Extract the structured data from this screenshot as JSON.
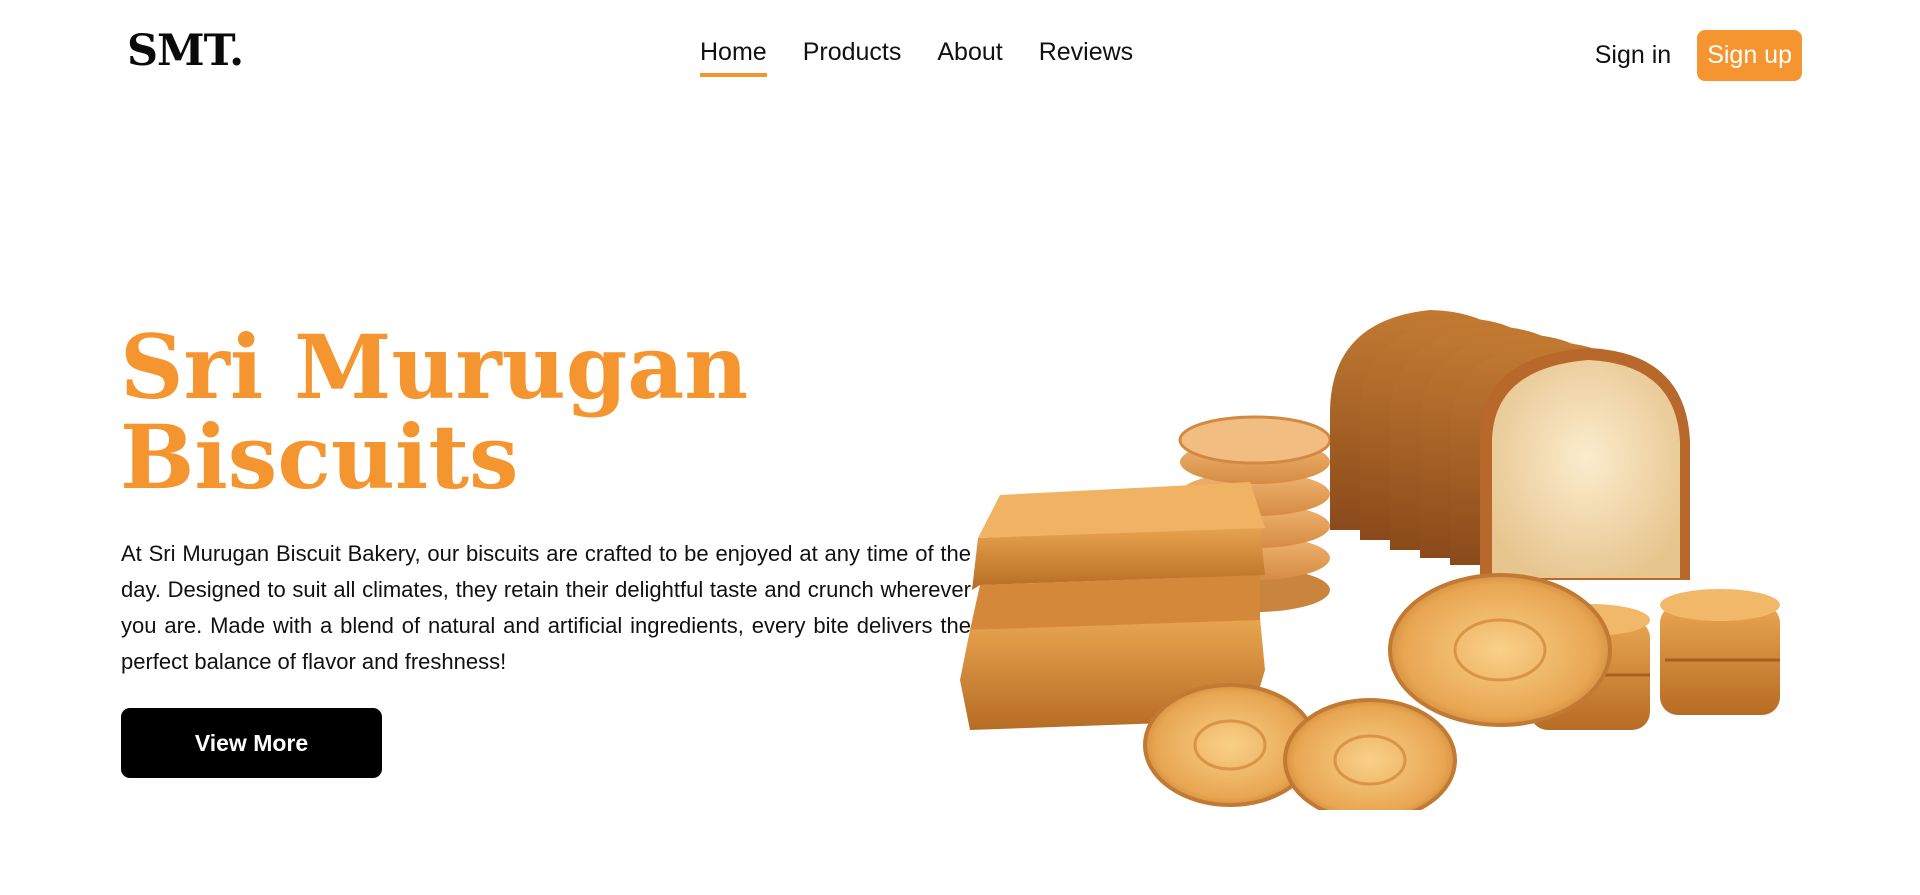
{
  "brand": {
    "logo": "SMT.",
    "accent_color": "#f5952f"
  },
  "nav": {
    "items": [
      {
        "label": "Home",
        "active": true
      },
      {
        "label": "Products",
        "active": false
      },
      {
        "label": "About",
        "active": false
      },
      {
        "label": "Reviews",
        "active": false
      }
    ]
  },
  "auth": {
    "signin_label": "Sign in",
    "signup_label": "Sign up"
  },
  "hero": {
    "title_line1": "Sri Murugan",
    "title_line2": "Biscuits",
    "description": "At Sri Murugan Biscuit Bakery, our biscuits are crafted to be enjoyed at any time of the day. Designed to suit all climates, they retain their delightful taste and crunch wherever you are. Made with a blend of natural and artificial ingredients, every bite delivers the perfect balance of flavor and freshness!",
    "cta_label": "View More",
    "image_icon": "bakery-products-image"
  }
}
